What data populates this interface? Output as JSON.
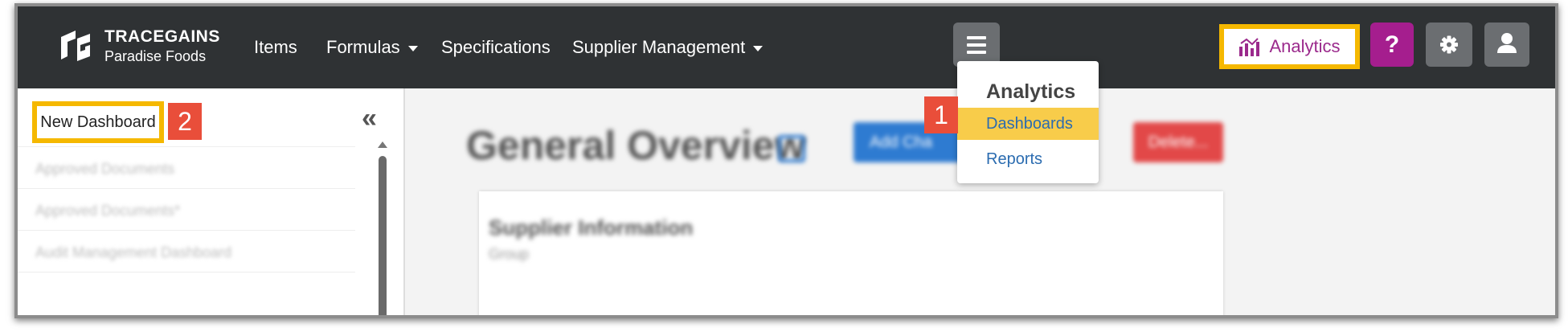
{
  "brand": {
    "name": "TRACEGAINS",
    "subtitle": "Paradise Foods"
  },
  "nav": {
    "items": [
      {
        "label": "Items"
      },
      {
        "label": "Formulas"
      },
      {
        "label": "Specifications"
      },
      {
        "label": "Supplier Management"
      }
    ],
    "analytics_label": "Analytics",
    "help_label": "?"
  },
  "dropdown": {
    "header": "Analytics",
    "items": [
      {
        "label": "Dashboards"
      },
      {
        "label": "Reports"
      }
    ]
  },
  "sidebar": {
    "new_dashboard_label": "New Dashboard",
    "collapse_glyph": "«",
    "items": [
      {
        "label": "Approved Documents"
      },
      {
        "label": "Approved Documents*"
      },
      {
        "label": "Audit Management Dashboard"
      }
    ]
  },
  "main": {
    "title": "General Overview",
    "add_label": "Add Cha",
    "delete_label": "Delete...",
    "card_title": "Supplier Information",
    "card_subtitle": "Group"
  },
  "callouts": {
    "step1": "1",
    "step2": "2"
  },
  "colors": {
    "nav_bg": "#2f3234",
    "highlight": "#f5b800",
    "analytics_purple": "#9b2a8c",
    "help_magenta": "#a51e8e",
    "callout_red": "#e94e3a",
    "link_blue": "#2b6cb0",
    "active_item": "#f8cc4a"
  }
}
